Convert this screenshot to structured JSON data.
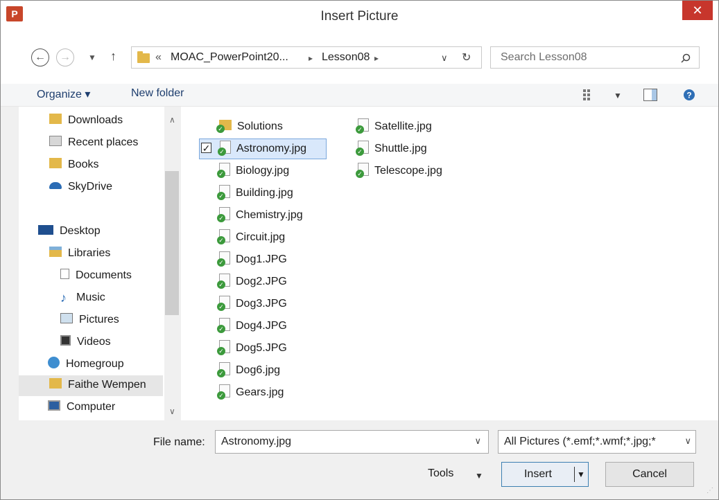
{
  "window": {
    "title": "Insert Picture",
    "app_icon": "P",
    "close_glyph": "✕"
  },
  "nav": {
    "back_icon": "arrow-left-icon",
    "forward_icon": "arrow-right-icon",
    "crumbs": [
      "«",
      "MOAC_PowerPoint20...",
      "▸",
      "Lesson08",
      "▸"
    ],
    "search_placeholder": "Search Lesson08"
  },
  "toolbar": {
    "organize": "Organize ▾",
    "new_folder": "New folder"
  },
  "sidebar": {
    "items": [
      {
        "label": "Downloads"
      },
      {
        "label": "Recent places"
      },
      {
        "label": "Books"
      },
      {
        "label": "SkyDrive"
      },
      {
        "label": "Desktop"
      },
      {
        "label": "Libraries"
      },
      {
        "label": "Documents"
      },
      {
        "label": "Music"
      },
      {
        "label": "Pictures"
      },
      {
        "label": "Videos"
      },
      {
        "label": "Homegroup"
      },
      {
        "label": "Faithe Wempen"
      },
      {
        "label": "Computer"
      }
    ]
  },
  "files": {
    "col1": [
      "Solutions",
      "Astronomy.jpg",
      "Biology.jpg",
      "Building.jpg",
      "Chemistry.jpg",
      "Circuit.jpg",
      "Dog1.JPG",
      "Dog2.JPG",
      "Dog3.JPG",
      "Dog4.JPG",
      "Dog5.JPG",
      "Dog6.jpg",
      "Gears.jpg"
    ],
    "col2": [
      "Satellite.jpg",
      "Shuttle.jpg",
      "Telescope.jpg"
    ],
    "selected": "Astronomy.jpg"
  },
  "footer": {
    "file_name_label": "File name:",
    "file_name_value": "Astronomy.jpg",
    "filter": "All Pictures (*.emf;*.wmf;*.jpg;*",
    "tools": "Tools",
    "insert": "Insert",
    "cancel": "Cancel"
  }
}
